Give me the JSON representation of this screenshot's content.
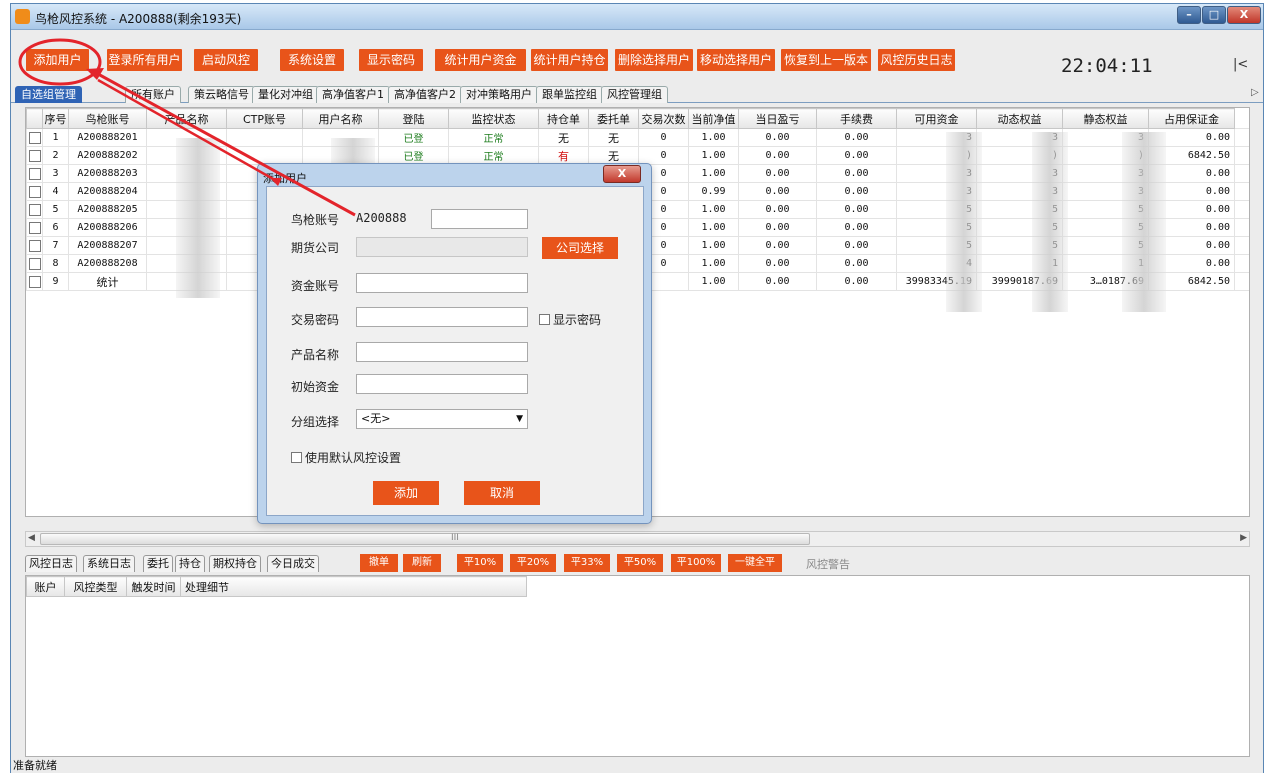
{
  "window": {
    "title": "鸟枪风控系统 - A200888(剩余193天)",
    "min": "–",
    "max": "□",
    "close": "X"
  },
  "toolbar": {
    "buttons": [
      "添加用户",
      "登录所有用户",
      "启动风控",
      "系统设置",
      "显示密码",
      "统计用户资金",
      "统计用户持仓",
      "删除选择用户",
      "移动选择用户",
      "恢复到上一版本",
      "风控历史日志"
    ],
    "clock": "22:04:11",
    "collapse": "|<"
  },
  "tabs": [
    "自选组管理",
    "所有账户",
    "策云略信号",
    "量化对冲组",
    "高净值客户1",
    "高净值客户2",
    "对冲策略用户",
    "跟单监控组",
    "风控管理组"
  ],
  "tab_scroll": "▷",
  "grid": {
    "columns": [
      "序号",
      "鸟枪账号",
      "产品名称",
      "CTP账号",
      "用户名称",
      "登陆",
      "监控状态",
      "持仓单",
      "委托单",
      "交易次数",
      "当前净值",
      "当日盈亏",
      "手续费",
      "可用资金",
      "动态权益",
      "静态权益",
      "占用保证金"
    ],
    "rows": [
      [
        "1",
        "A200888201",
        "",
        "",
        "",
        "已登",
        "正常",
        "无",
        "无",
        "0",
        "1.00",
        "0.00",
        "0.00",
        "3",
        "3",
        "3",
        "0.00"
      ],
      [
        "2",
        "A200888202",
        "",
        "",
        "",
        "已登",
        "正常",
        "有",
        "无",
        "0",
        "1.00",
        "0.00",
        "0.00",
        ")",
        ")",
        ")",
        "6842.50"
      ],
      [
        "3",
        "A200888203",
        "",
        "",
        "",
        "",
        "",
        "",
        "",
        "0",
        "1.00",
        "0.00",
        "0.00",
        "3",
        "3",
        "3",
        "0.00"
      ],
      [
        "4",
        "A200888204",
        "",
        "",
        "",
        "",
        "",
        "",
        "",
        "0",
        "0.99",
        "0.00",
        "0.00",
        "3",
        "3",
        "3",
        "0.00"
      ],
      [
        "5",
        "A200888205",
        "",
        "",
        "",
        "",
        "",
        "",
        "",
        "0",
        "1.00",
        "0.00",
        "0.00",
        "5",
        "5",
        "5",
        "0.00"
      ],
      [
        "6",
        "A200888206",
        "",
        "",
        "",
        "",
        "",
        "",
        "",
        "0",
        "1.00",
        "0.00",
        "0.00",
        "5",
        "5",
        "5",
        "0.00"
      ],
      [
        "7",
        "A200888207",
        "",
        "",
        "",
        "",
        "",
        "",
        "",
        "0",
        "1.00",
        "0.00",
        "0.00",
        "5",
        "5",
        "5",
        "0.00"
      ],
      [
        "8",
        "A200888208",
        "",
        "",
        "",
        "",
        "",
        "",
        "",
        "0",
        "1.00",
        "0.00",
        "0.00",
        "4",
        "1",
        "1",
        "0.00"
      ],
      [
        "9",
        "统计",
        "",
        "",
        "",
        "",
        "",
        "",
        "",
        "",
        "1.00",
        "0.00",
        "0.00",
        "39983345.19",
        "39990187.69",
        "3…0187.69",
        "6842.50"
      ]
    ]
  },
  "scroll": {
    "left": "◀",
    "right": "▶",
    "grip": "III"
  },
  "bottom_tabs": [
    "风控日志",
    "系统日志",
    "委托",
    "持仓",
    "期权持仓",
    "今日成交"
  ],
  "actions": [
    "撤单",
    "刷新",
    "平10%",
    "平20%",
    "平33%",
    "平50%",
    "平100%",
    "一键全平"
  ],
  "risk_warning": "风控警告",
  "log_columns": [
    "账户",
    "风控类型",
    "触发时间",
    "处理细节"
  ],
  "status": "准备就绪",
  "dialog": {
    "title": "添加用户",
    "close": "X",
    "account_label": "鸟枪账号",
    "account_prefix": "A200888",
    "account_value": "",
    "broker_label": "期货公司",
    "broker_button": "公司选择",
    "fund_account_label": "资金账号",
    "trade_password_label": "交易密码",
    "show_password_label": "显示密码",
    "product_name_label": "产品名称",
    "initial_fund_label": "初始资金",
    "group_label": "分组选择",
    "group_value": "<无>",
    "default_risk_label": "使用默认风控设置",
    "add_button": "添加",
    "cancel_button": "取消"
  },
  "colors": {
    "accent": "#e8541a",
    "title_bar": "#a9c8e8",
    "active_tab": "#2f63b5",
    "annotation": "#e3242b",
    "green_status": "#1c7c1c",
    "red_status": "#d21010"
  }
}
